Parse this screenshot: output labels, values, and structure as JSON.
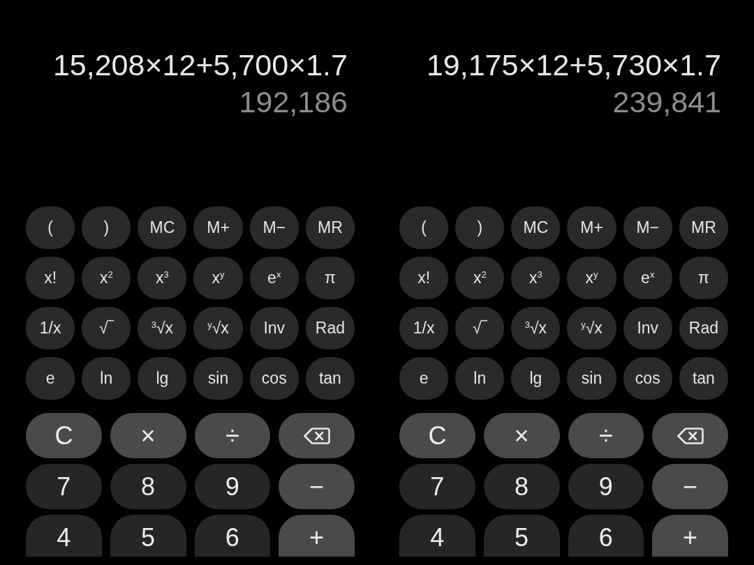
{
  "panes": [
    {
      "expression": "15,208×12+5,700×1.7",
      "result": "192,186",
      "scientific_keys": [
        [
          "(",
          ")",
          "MC",
          "M+",
          "M−",
          "MR"
        ],
        [
          "x!",
          "x$^{2}$",
          "x$^{3}$",
          "x$^{y}$",
          "e$^{x}$",
          "π"
        ],
        [
          "1/x",
          "√‾",
          "$^{3}$√x",
          "$^{y}$√x",
          "Inv",
          "Rad"
        ],
        [
          "e",
          "ln",
          "lg",
          "sin",
          "cos",
          "tan"
        ]
      ],
      "keys": [
        {
          "kind": "operator",
          "label": "C"
        },
        {
          "kind": "operator",
          "label": "×"
        },
        {
          "kind": "operator",
          "label": "÷"
        },
        {
          "kind": "backspace"
        },
        {
          "kind": "digit",
          "label": "7"
        },
        {
          "kind": "digit",
          "label": "8"
        },
        {
          "kind": "digit",
          "label": "9"
        },
        {
          "kind": "operator",
          "label": "−"
        },
        {
          "kind": "digit",
          "label": "4"
        },
        {
          "kind": "digit",
          "label": "5"
        },
        {
          "kind": "digit",
          "label": "6"
        },
        {
          "kind": "operator",
          "label": "+"
        }
      ]
    },
    {
      "expression": "19,175×12+5,730×1.7",
      "result": "239,841",
      "scientific_keys": [
        [
          "(",
          ")",
          "MC",
          "M+",
          "M−",
          "MR"
        ],
        [
          "x!",
          "x$^{2}$",
          "x$^{3}$",
          "x$^{y}$",
          "e$^{x}$",
          "π"
        ],
        [
          "1/x",
          "√‾",
          "$^{3}$√x",
          "$^{y}$√x",
          "Inv",
          "Rad"
        ],
        [
          "e",
          "ln",
          "lg",
          "sin",
          "cos",
          "tan"
        ]
      ],
      "keys": [
        {
          "kind": "operator",
          "label": "C"
        },
        {
          "kind": "operator",
          "label": "×"
        },
        {
          "kind": "operator",
          "label": "÷"
        },
        {
          "kind": "backspace"
        },
        {
          "kind": "digit",
          "label": "7"
        },
        {
          "kind": "digit",
          "label": "8"
        },
        {
          "kind": "digit",
          "label": "9"
        },
        {
          "kind": "operator",
          "label": "−"
        },
        {
          "kind": "digit",
          "label": "4"
        },
        {
          "kind": "digit",
          "label": "5"
        },
        {
          "kind": "digit",
          "label": "6"
        },
        {
          "kind": "operator",
          "label": "+"
        }
      ]
    }
  ]
}
